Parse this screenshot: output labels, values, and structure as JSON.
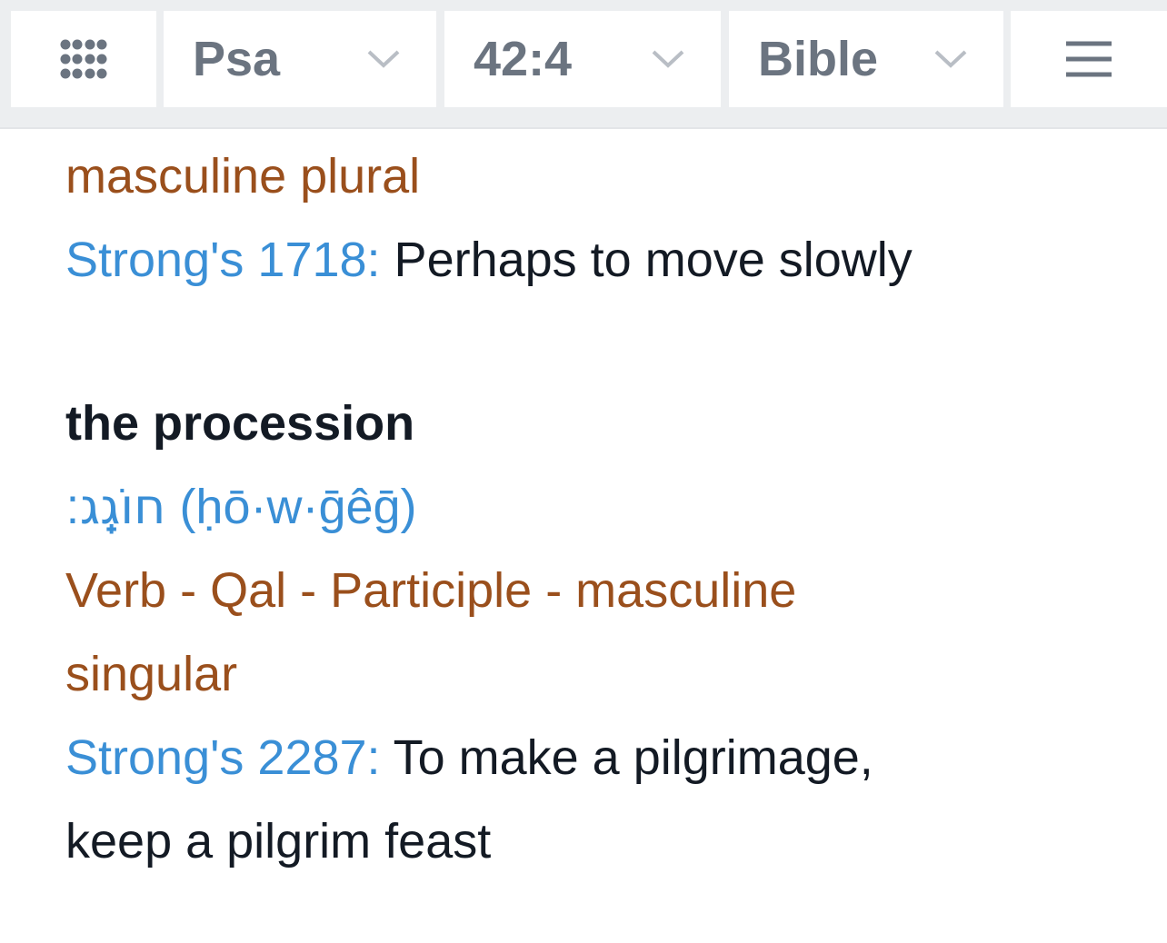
{
  "toolbar": {
    "grid_icon": "grid-dots-icon",
    "book": "Psa",
    "verse": "42:4",
    "version": "Bible",
    "chevron_icon": "chevron-down-icon",
    "menu_icon": "hamburger-menu-icon",
    "text_color": "#6b7480",
    "background": "#eceef0"
  },
  "entries": {
    "prev_parse": "masculine plural",
    "prev_strongs_label": "Strong's 1718:",
    "prev_strongs_def": " Perhaps to move slowly",
    "word_heading": "the procession",
    "hebrew": "חוֹגֵֽג׃",
    "transliteration": " (ḥō·w·ḡêḡ)",
    "parse_line1": "Verb - Qal - Participle - masculine",
    "parse_line2": "singular",
    "strongs_label": "Strong's 2287:",
    "strongs_def_line1": " To make a pilgrimage,",
    "strongs_def_line2": "keep a pilgrim feast"
  },
  "colors": {
    "parse": "#9a4f1c",
    "strongs_link": "#3a8fd6",
    "text": "#131a24"
  }
}
